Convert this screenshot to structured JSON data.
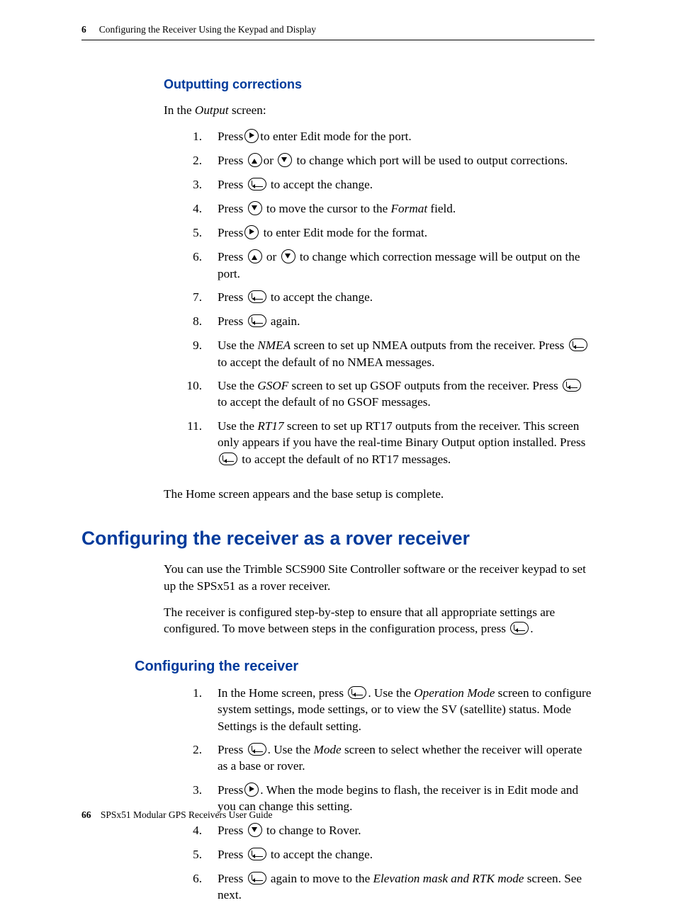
{
  "running_head": {
    "chapter_num": "6",
    "chapter_title": "Configuring the Receiver Using the Keypad and Display"
  },
  "section_h3_1": "Outputting corrections",
  "intro_1_a": "In the ",
  "intro_1_b": "Output",
  "intro_1_c": " screen:",
  "steps_a": {
    "s1_a": "Press",
    "s1_b": "to enter Edit mode for the port.",
    "s2_a": "Press",
    "s2_b": "or",
    "s2_c": " to change which port will be used to output corrections.",
    "s3_a": "Press ",
    "s3_b": " to accept the change.",
    "s4_a": "Press ",
    "s4_b": " to move the cursor to the ",
    "s4_c": "Format",
    "s4_d": " field.",
    "s5_a": "Press",
    "s5_b": " to enter Edit mode for the format.",
    "s6_a": "Press ",
    "s6_b": " or ",
    "s6_c": " to change which correction message will be output on the port.",
    "s7_a": "Press ",
    "s7_b": " to accept the change.",
    "s8_a": "Press ",
    "s8_b": " again.",
    "s9_a": "Use the ",
    "s9_b": "NMEA",
    "s9_c": " screen to set up NMEA outputs from the receiver. Press ",
    "s9_d": " to accept the default of no NMEA messages.",
    "s10_a": "Use the ",
    "s10_b": "GSOF",
    "s10_c": " screen to set up GSOF outputs from the receiver. Press ",
    "s10_d": " to accept the default of no GSOF messages.",
    "s11_a": "Use the ",
    "s11_b": "RT17",
    "s11_c": " screen to set up RT17 outputs from the receiver. This screen only appears if you have the real-time Binary Output option installed. Press ",
    "s11_d": " to accept the default of no RT17 messages."
  },
  "closing_1": "The Home screen appears and the base setup is complete.",
  "h1_1": "Configuring the receiver as a rover receiver",
  "para_1": "You can use the Trimble SCS900 Site Controller software or the receiver keypad to set up the SPSx51 as a rover receiver.",
  "para_2_a": "The receiver is configured step-by-step to ensure that all appropriate settings are configured. To move between steps in the configuration process, press ",
  "para_2_b": ".",
  "h2_1": "Configuring the receiver",
  "steps_b": {
    "s1_a": "In the Home screen, press ",
    "s1_b": ". Use the ",
    "s1_c": "Operation Mode",
    "s1_d": " screen to configure system settings, mode settings, or to view the SV (satellite) status. Mode Settings is the default setting.",
    "s2_a": "Press ",
    "s2_b": ". Use the ",
    "s2_c": "Mode",
    "s2_d": " screen to select whether the receiver will operate as a base or rover.",
    "s3_a": "Press",
    "s3_b": ". When the mode begins to flash, the receiver is in Edit mode and you can change this setting.",
    "s4_a": "Press ",
    "s4_b": " to change to Rover.",
    "s5_a": "Press ",
    "s5_b": " to accept the change.",
    "s6_a": "Press ",
    "s6_b": " again to move to the ",
    "s6_c": "Elevation mask and RTK mode",
    "s6_d": " screen. See next."
  },
  "footer": {
    "page_num": "66",
    "doc_title": "SPSx51 Modular GPS Receivers User Guide"
  }
}
